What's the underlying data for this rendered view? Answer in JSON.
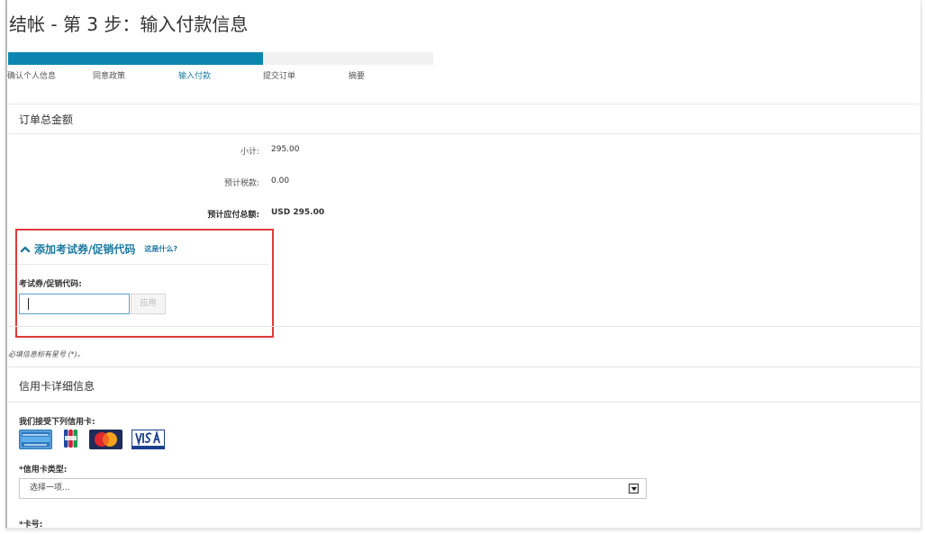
{
  "page": {
    "title": "结帐 - 第 3 步：输入付款信息"
  },
  "progress": {
    "value_percent": 60,
    "fill_color": "#0c86b0",
    "steps": [
      {
        "label": "确认个人信息",
        "active": false
      },
      {
        "label": "同意政策",
        "active": false
      },
      {
        "label": "输入付款",
        "active": true
      },
      {
        "label": "提交订单",
        "active": false
      },
      {
        "label": "摘要",
        "active": false
      }
    ]
  },
  "order_total": {
    "heading": "订单总金额",
    "subtotal_label": "小计:",
    "subtotal_value": "295.00",
    "tax_label": "预计税款:",
    "tax_value": "0.00",
    "total_label": "预计应付总额:",
    "total_value": "USD 295.00"
  },
  "promo": {
    "heading": "添加考试券/促销代码",
    "help_link": "这是什么?",
    "field_label": "考试券/促销代码:",
    "input_value": "",
    "apply_label": "应用",
    "highlight_color": "#e03a3a",
    "icon": "chevron-up-icon"
  },
  "required_note": "必填信息标有星号 (*)。",
  "card_details": {
    "heading": "信用卡详细信息",
    "accepted_label": "我们接受下列信用卡:",
    "accepted_cards": [
      {
        "name": "American Express",
        "icon": "amex-card-icon"
      },
      {
        "name": "JCB",
        "icon": "jcb-card-icon"
      },
      {
        "name": "MasterCard",
        "icon": "mastercard-icon"
      },
      {
        "name": "VISA",
        "icon": "visa-card-icon"
      }
    ],
    "card_type_label": "*信用卡类型:",
    "card_type_selected": "选择一项...",
    "card_number_label": "*卡号:"
  }
}
